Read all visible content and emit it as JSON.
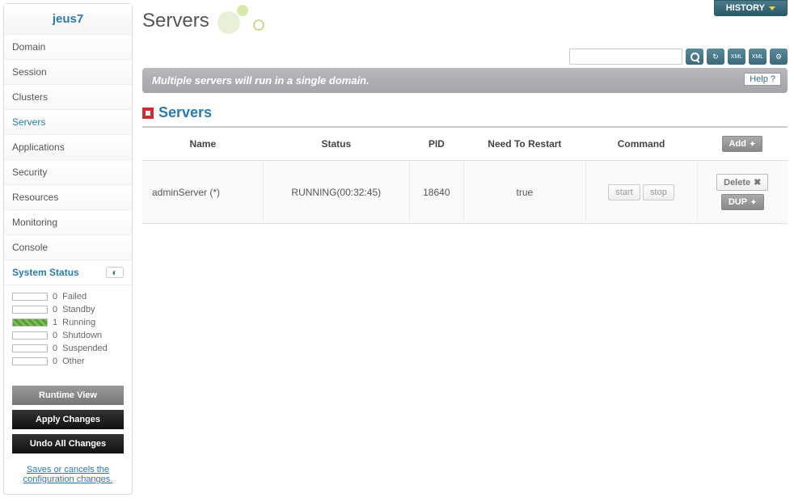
{
  "sidebar": {
    "title": "jeus7",
    "items": [
      {
        "label": "Domain"
      },
      {
        "label": "Session"
      },
      {
        "label": "Clusters"
      },
      {
        "label": "Servers"
      },
      {
        "label": "Applications"
      },
      {
        "label": "Security"
      },
      {
        "label": "Resources"
      },
      {
        "label": "Monitoring"
      },
      {
        "label": "Console"
      }
    ],
    "status_header": "System Status",
    "status": [
      {
        "count": 0,
        "label": "Failed",
        "cls": ""
      },
      {
        "count": 0,
        "label": "Standby",
        "cls": ""
      },
      {
        "count": 1,
        "label": "Running",
        "cls": "running"
      },
      {
        "count": 0,
        "label": "Shutdown",
        "cls": ""
      },
      {
        "count": 0,
        "label": "Suspended",
        "cls": ""
      },
      {
        "count": 0,
        "label": "Other",
        "cls": ""
      }
    ],
    "buttons": {
      "runtime": "Runtime View",
      "apply": "Apply Changes",
      "undo": "Undo All Changes"
    },
    "note": "Saves or cancels the configuration changes."
  },
  "header": {
    "history": "HISTORY",
    "title": "Servers"
  },
  "toolbar": {
    "search_placeholder": "",
    "icons": [
      "search",
      "refresh",
      "export-xml",
      "import-xml",
      "settings"
    ]
  },
  "info_bar": {
    "text": "Multiple servers will run in a single domain.",
    "help": "Help"
  },
  "section": {
    "title": "Servers"
  },
  "table": {
    "columns": [
      "Name",
      "Status",
      "PID",
      "Need To Restart",
      "Command",
      ""
    ],
    "add_label": "Add",
    "rows": [
      {
        "name": "adminServer (*)",
        "status": "RUNNING(00:32:45)",
        "pid": "18640",
        "restart": "true",
        "cmd_start": "start",
        "cmd_stop": "stop",
        "act_delete": "Delete",
        "act_dup": "DUP"
      }
    ]
  }
}
